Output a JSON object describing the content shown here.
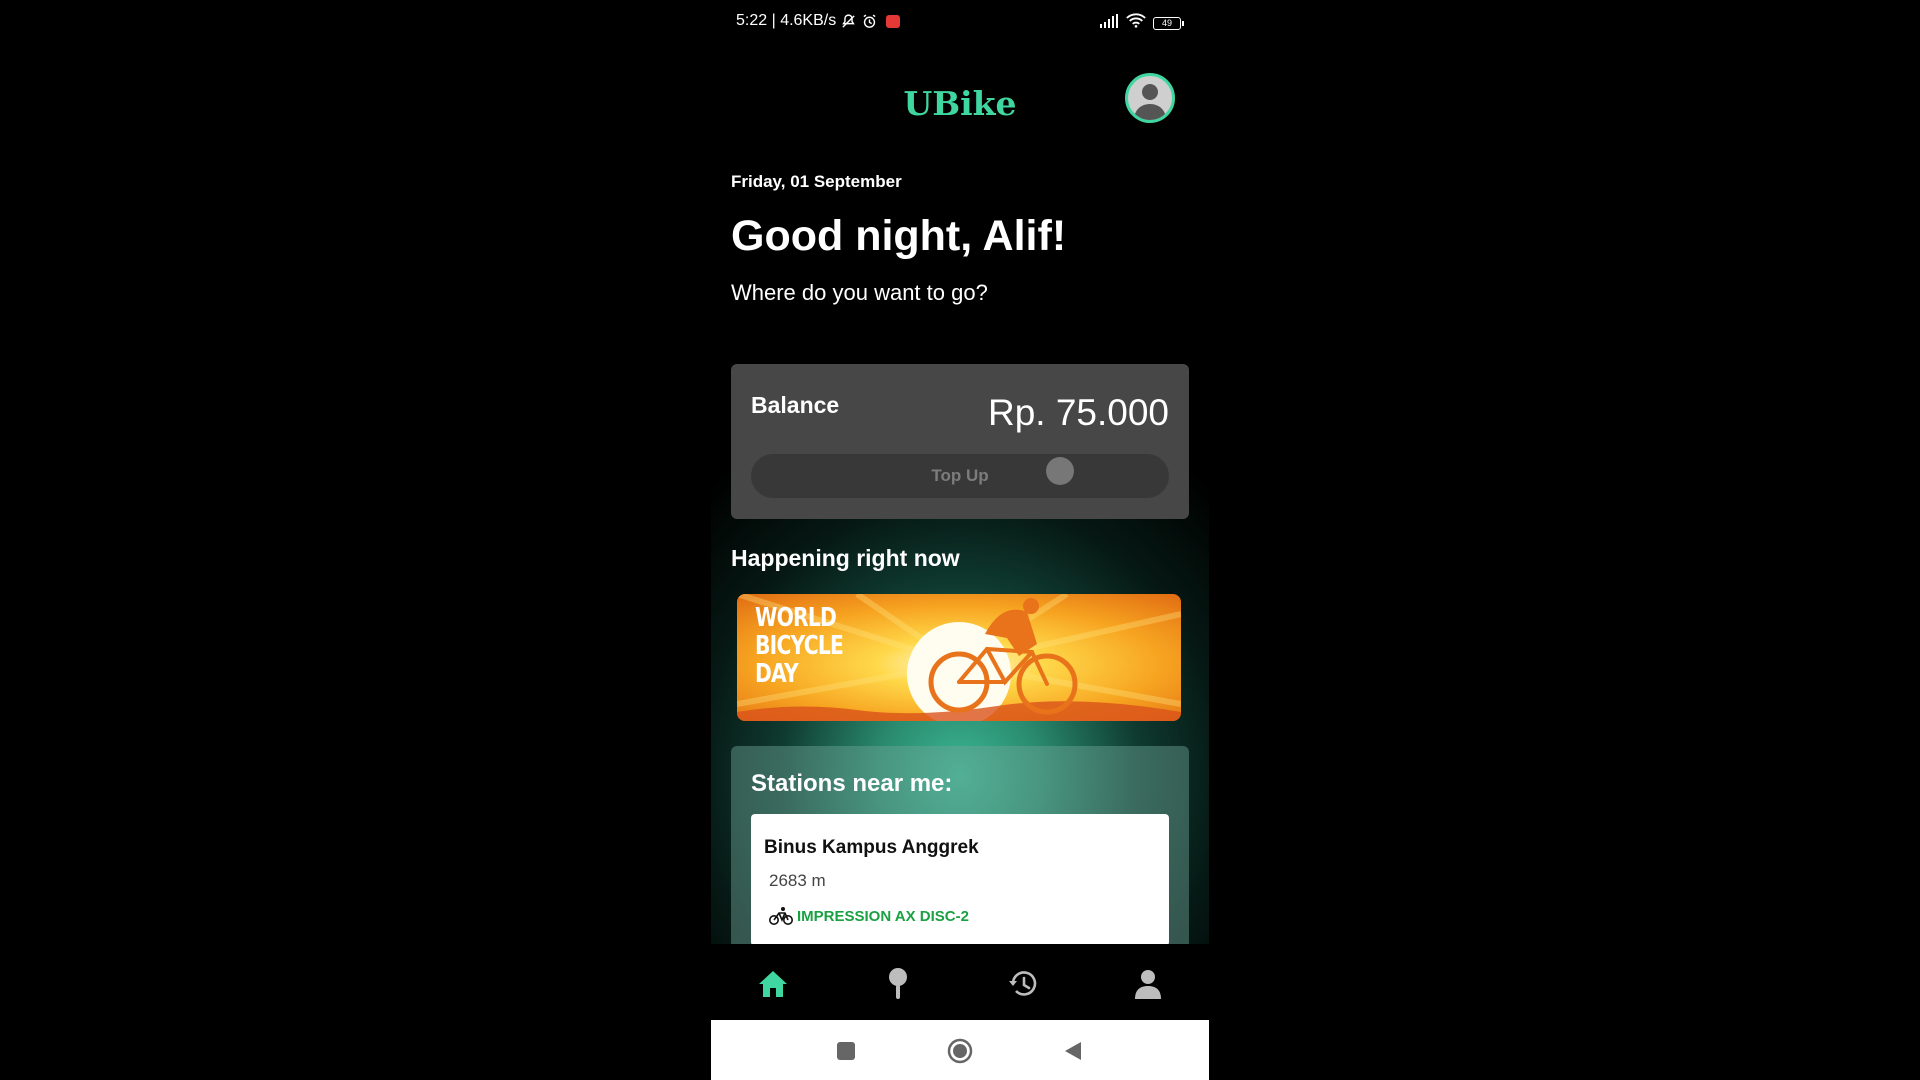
{
  "status_bar": {
    "time_speed": "5:22 | 4.6KB/s",
    "battery": "49"
  },
  "header": {
    "app_title": "UBike"
  },
  "greeting": {
    "date": "Friday, 01 September",
    "title": "Good night, Alif!",
    "subtitle": "Where do you want to go?"
  },
  "balance": {
    "label": "Balance",
    "value": "Rp. 75.000",
    "topup_label": "Top Up"
  },
  "happening": {
    "title": "Happening right now",
    "banner_text": "WORLD BICYCLE DAY"
  },
  "stations": {
    "title": "Stations near me:",
    "items": [
      {
        "name": "Binus Kampus Anggrek",
        "distance": "2683 m",
        "bike": "IMPRESSION AX DISC-2"
      }
    ]
  },
  "bottom_nav": {
    "items": [
      "home-icon",
      "map-pin-icon",
      "history-icon",
      "person-icon"
    ],
    "active": "home-icon"
  },
  "colors": {
    "accent": "#3fd6a0",
    "card": "#474747",
    "bike_label": "#1aa142"
  }
}
